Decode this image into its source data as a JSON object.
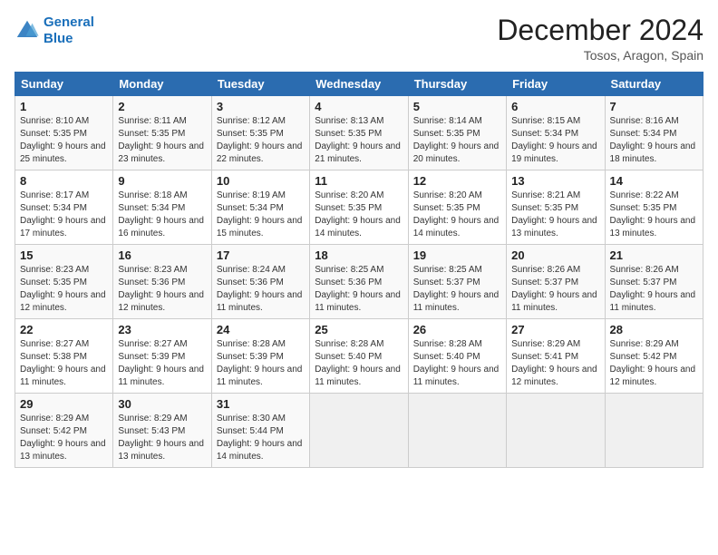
{
  "logo": {
    "line1": "General",
    "line2": "Blue"
  },
  "title": "December 2024",
  "location": "Tosos, Aragon, Spain",
  "days_of_week": [
    "Sunday",
    "Monday",
    "Tuesday",
    "Wednesday",
    "Thursday",
    "Friday",
    "Saturday"
  ],
  "weeks": [
    [
      {
        "day": "1",
        "sunrise": "8:10 AM",
        "sunset": "5:35 PM",
        "daylight": "9 hours and 25 minutes."
      },
      {
        "day": "2",
        "sunrise": "8:11 AM",
        "sunset": "5:35 PM",
        "daylight": "9 hours and 23 minutes."
      },
      {
        "day": "3",
        "sunrise": "8:12 AM",
        "sunset": "5:35 PM",
        "daylight": "9 hours and 22 minutes."
      },
      {
        "day": "4",
        "sunrise": "8:13 AM",
        "sunset": "5:35 PM",
        "daylight": "9 hours and 21 minutes."
      },
      {
        "day": "5",
        "sunrise": "8:14 AM",
        "sunset": "5:35 PM",
        "daylight": "9 hours and 20 minutes."
      },
      {
        "day": "6",
        "sunrise": "8:15 AM",
        "sunset": "5:34 PM",
        "daylight": "9 hours and 19 minutes."
      },
      {
        "day": "7",
        "sunrise": "8:16 AM",
        "sunset": "5:34 PM",
        "daylight": "9 hours and 18 minutes."
      }
    ],
    [
      {
        "day": "8",
        "sunrise": "8:17 AM",
        "sunset": "5:34 PM",
        "daylight": "9 hours and 17 minutes."
      },
      {
        "day": "9",
        "sunrise": "8:18 AM",
        "sunset": "5:34 PM",
        "daylight": "9 hours and 16 minutes."
      },
      {
        "day": "10",
        "sunrise": "8:19 AM",
        "sunset": "5:34 PM",
        "daylight": "9 hours and 15 minutes."
      },
      {
        "day": "11",
        "sunrise": "8:20 AM",
        "sunset": "5:35 PM",
        "daylight": "9 hours and 14 minutes."
      },
      {
        "day": "12",
        "sunrise": "8:20 AM",
        "sunset": "5:35 PM",
        "daylight": "9 hours and 14 minutes."
      },
      {
        "day": "13",
        "sunrise": "8:21 AM",
        "sunset": "5:35 PM",
        "daylight": "9 hours and 13 minutes."
      },
      {
        "day": "14",
        "sunrise": "8:22 AM",
        "sunset": "5:35 PM",
        "daylight": "9 hours and 13 minutes."
      }
    ],
    [
      {
        "day": "15",
        "sunrise": "8:23 AM",
        "sunset": "5:35 PM",
        "daylight": "9 hours and 12 minutes."
      },
      {
        "day": "16",
        "sunrise": "8:23 AM",
        "sunset": "5:36 PM",
        "daylight": "9 hours and 12 minutes."
      },
      {
        "day": "17",
        "sunrise": "8:24 AM",
        "sunset": "5:36 PM",
        "daylight": "9 hours and 11 minutes."
      },
      {
        "day": "18",
        "sunrise": "8:25 AM",
        "sunset": "5:36 PM",
        "daylight": "9 hours and 11 minutes."
      },
      {
        "day": "19",
        "sunrise": "8:25 AM",
        "sunset": "5:37 PM",
        "daylight": "9 hours and 11 minutes."
      },
      {
        "day": "20",
        "sunrise": "8:26 AM",
        "sunset": "5:37 PM",
        "daylight": "9 hours and 11 minutes."
      },
      {
        "day": "21",
        "sunrise": "8:26 AM",
        "sunset": "5:37 PM",
        "daylight": "9 hours and 11 minutes."
      }
    ],
    [
      {
        "day": "22",
        "sunrise": "8:27 AM",
        "sunset": "5:38 PM",
        "daylight": "9 hours and 11 minutes."
      },
      {
        "day": "23",
        "sunrise": "8:27 AM",
        "sunset": "5:39 PM",
        "daylight": "9 hours and 11 minutes."
      },
      {
        "day": "24",
        "sunrise": "8:28 AM",
        "sunset": "5:39 PM",
        "daylight": "9 hours and 11 minutes."
      },
      {
        "day": "25",
        "sunrise": "8:28 AM",
        "sunset": "5:40 PM",
        "daylight": "9 hours and 11 minutes."
      },
      {
        "day": "26",
        "sunrise": "8:28 AM",
        "sunset": "5:40 PM",
        "daylight": "9 hours and 11 minutes."
      },
      {
        "day": "27",
        "sunrise": "8:29 AM",
        "sunset": "5:41 PM",
        "daylight": "9 hours and 12 minutes."
      },
      {
        "day": "28",
        "sunrise": "8:29 AM",
        "sunset": "5:42 PM",
        "daylight": "9 hours and 12 minutes."
      }
    ],
    [
      {
        "day": "29",
        "sunrise": "8:29 AM",
        "sunset": "5:42 PM",
        "daylight": "9 hours and 13 minutes."
      },
      {
        "day": "30",
        "sunrise": "8:29 AM",
        "sunset": "5:43 PM",
        "daylight": "9 hours and 13 minutes."
      },
      {
        "day": "31",
        "sunrise": "8:30 AM",
        "sunset": "5:44 PM",
        "daylight": "9 hours and 14 minutes."
      },
      null,
      null,
      null,
      null
    ]
  ]
}
